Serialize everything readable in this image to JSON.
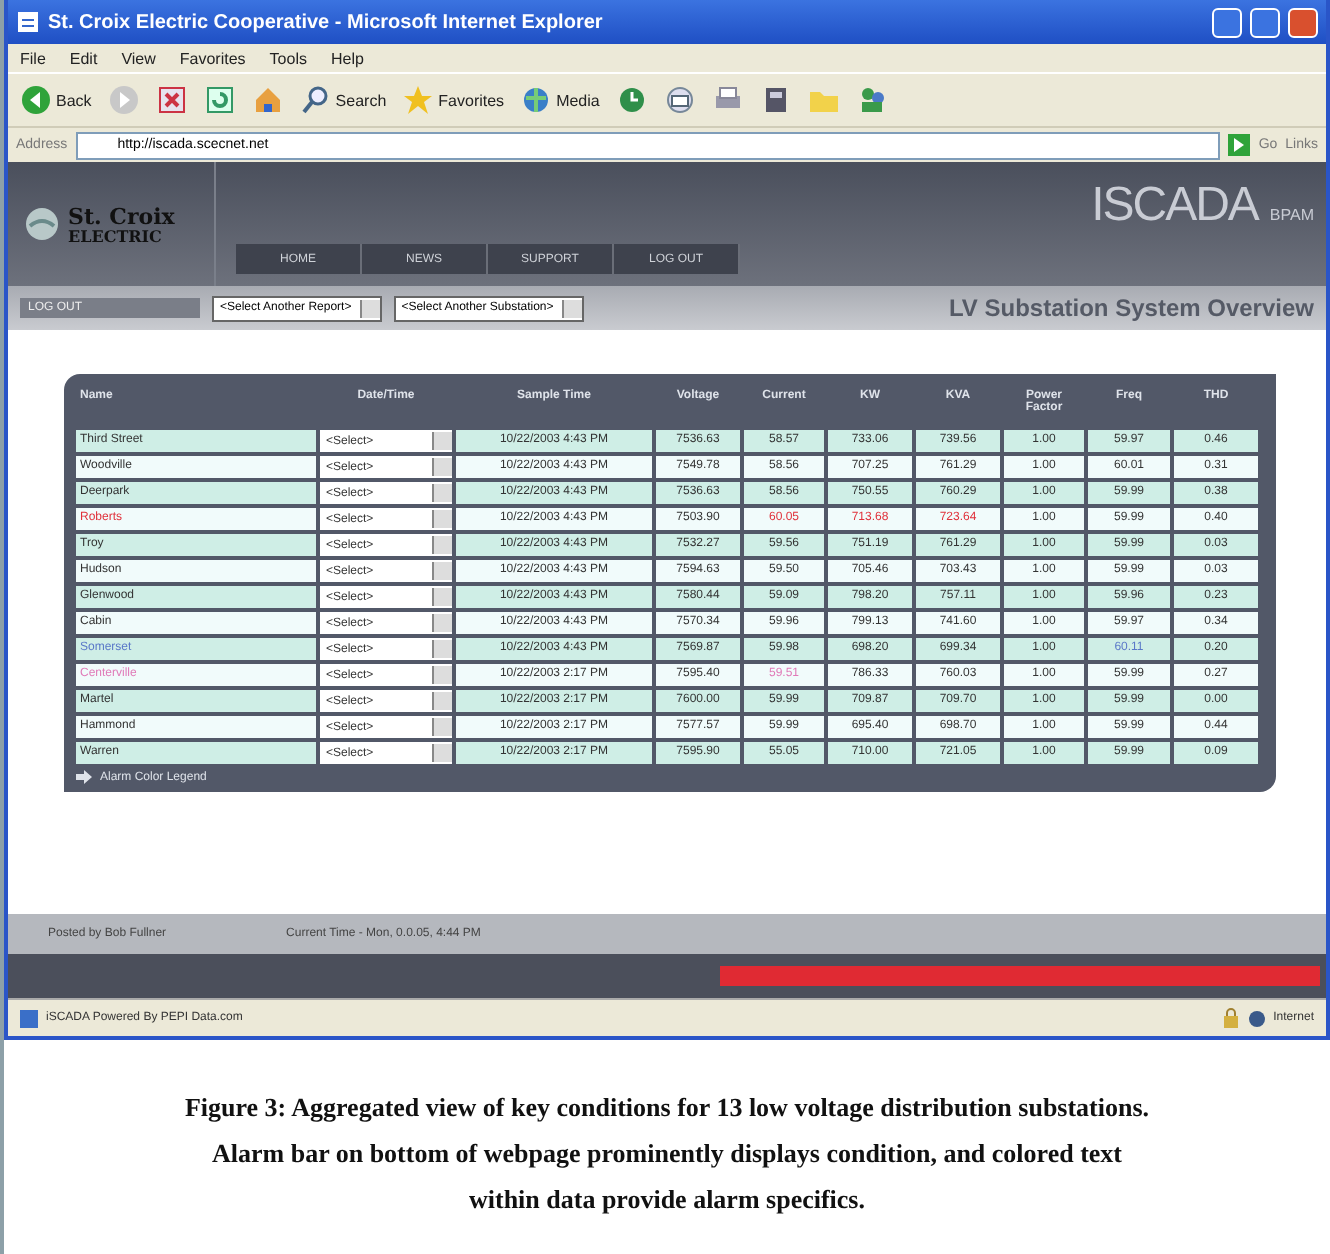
{
  "window": {
    "title": "St. Croix Electric Cooperative - Microsoft Internet Explorer"
  },
  "menu": [
    "File",
    "Edit",
    "View",
    "Favorites",
    "Tools",
    "Help"
  ],
  "toolbar": [
    {
      "kind": "back",
      "label": "Back"
    },
    {
      "kind": "forward"
    },
    {
      "kind": "stop"
    },
    {
      "kind": "refresh"
    },
    {
      "kind": "home"
    },
    {
      "kind": "search",
      "label": "Search"
    },
    {
      "kind": "favorites",
      "label": "Favorites"
    },
    {
      "kind": "media",
      "label": "Media"
    },
    {
      "kind": "history"
    },
    {
      "kind": "mail"
    },
    {
      "kind": "print"
    },
    {
      "kind": "edit"
    },
    {
      "kind": "folder"
    },
    {
      "kind": "messenger"
    }
  ],
  "address": {
    "label": "Address",
    "value": "http://iscada.scecnet.net",
    "go": "Go",
    "links": "Links"
  },
  "site": {
    "logo_line1": "St. Croix",
    "logo_line2": "ELECTRIC",
    "brand": "ISCADA",
    "brand_sub": "BPAM",
    "nav": [
      {
        "label": "HOME",
        "selected": false
      },
      {
        "label": "NEWS",
        "selected": false
      },
      {
        "label": "SUPPORT",
        "selected": false
      },
      {
        "label": "LOG OUT",
        "selected": false
      }
    ],
    "user": "LOG OUT",
    "selects": [
      "<Select Another Report>",
      "<Select Another Substation>"
    ],
    "page_title": "LV Substation System Overview"
  },
  "table": {
    "columns": [
      "Name",
      "Date/Time",
      "Sample Time",
      "Voltage",
      "Current",
      "KW",
      "KVA",
      "Power Factor",
      "Freq",
      "THD"
    ],
    "rows": [
      {
        "cells": [
          {
            "kind": "link",
            "text": "Third Street"
          },
          {
            "kind": "select",
            "text": "<Select>"
          },
          {
            "text": "10/22/2003 4:43 PM"
          },
          {
            "text": "7536.63"
          },
          {
            "text": "58.57"
          },
          {
            "text": "733.06"
          },
          {
            "text": "739.56"
          },
          {
            "text": "1.00"
          },
          {
            "text": "59.97"
          },
          {
            "text": "0.46"
          }
        ]
      },
      {
        "cells": [
          {
            "kind": "link",
            "text": "Woodville"
          },
          {
            "kind": "select",
            "text": "<Select>"
          },
          {
            "text": "10/22/2003 4:43 PM"
          },
          {
            "text": "7549.78"
          },
          {
            "text": "58.56"
          },
          {
            "text": "707.25"
          },
          {
            "text": "761.29"
          },
          {
            "text": "1.00"
          },
          {
            "text": "60.01"
          },
          {
            "text": "0.31"
          }
        ]
      },
      {
        "cells": [
          {
            "kind": "link",
            "text": "Deerpark"
          },
          {
            "kind": "select",
            "text": "<Select>"
          },
          {
            "text": "10/22/2003 4:43 PM"
          },
          {
            "text": "7536.63"
          },
          {
            "text": "58.56"
          },
          {
            "text": "750.55"
          },
          {
            "text": "760.29"
          },
          {
            "text": "1.00"
          },
          {
            "text": "59.99"
          },
          {
            "text": "0.38"
          }
        ]
      },
      {
        "cells": [
          {
            "kind": "link",
            "text": "Roberts",
            "color": "#e0303a"
          },
          {
            "kind": "select",
            "text": "<Select>"
          },
          {
            "text": "10/22/2003 4:43 PM"
          },
          {
            "text": "7503.90"
          },
          {
            "text": "60.05",
            "color": "#e0303a"
          },
          {
            "text": "713.68",
            "color": "#e0303a"
          },
          {
            "text": "723.64",
            "color": "#e0303a"
          },
          {
            "text": "1.00"
          },
          {
            "text": "59.99"
          },
          {
            "text": "0.40"
          }
        ]
      },
      {
        "cells": [
          {
            "kind": "link",
            "text": "Troy"
          },
          {
            "kind": "select",
            "text": "<Select>"
          },
          {
            "text": "10/22/2003 4:43 PM"
          },
          {
            "text": "7532.27"
          },
          {
            "text": "59.56"
          },
          {
            "text": "751.19"
          },
          {
            "text": "761.29"
          },
          {
            "text": "1.00"
          },
          {
            "text": "59.99"
          },
          {
            "text": "0.03"
          }
        ]
      },
      {
        "cells": [
          {
            "kind": "link",
            "text": "Hudson"
          },
          {
            "kind": "select",
            "text": "<Select>"
          },
          {
            "text": "10/22/2003 4:43 PM"
          },
          {
            "text": "7594.63"
          },
          {
            "text": "59.50"
          },
          {
            "text": "705.46"
          },
          {
            "text": "703.43"
          },
          {
            "text": "1.00"
          },
          {
            "text": "59.99"
          },
          {
            "text": "0.03"
          }
        ]
      },
      {
        "cells": [
          {
            "kind": "link",
            "text": "Glenwood"
          },
          {
            "kind": "select",
            "text": "<Select>"
          },
          {
            "text": "10/22/2003 4:43 PM"
          },
          {
            "text": "7580.44"
          },
          {
            "text": "59.09"
          },
          {
            "text": "798.20"
          },
          {
            "text": "757.11"
          },
          {
            "text": "1.00"
          },
          {
            "text": "59.96"
          },
          {
            "text": "0.23"
          }
        ]
      },
      {
        "cells": [
          {
            "kind": "link",
            "text": "Cabin"
          },
          {
            "kind": "select",
            "text": "<Select>"
          },
          {
            "text": "10/22/2003 4:43 PM"
          },
          {
            "text": "7570.34"
          },
          {
            "text": "59.96"
          },
          {
            "text": "799.13"
          },
          {
            "text": "741.60"
          },
          {
            "text": "1.00"
          },
          {
            "text": "59.97"
          },
          {
            "text": "0.34"
          }
        ]
      },
      {
        "cells": [
          {
            "kind": "link",
            "text": "Somerset",
            "color": "#5a78c8"
          },
          {
            "kind": "select",
            "text": "<Select>"
          },
          {
            "text": "10/22/2003 4:43 PM"
          },
          {
            "text": "7569.87"
          },
          {
            "text": "59.98"
          },
          {
            "text": "698.20"
          },
          {
            "text": "699.34"
          },
          {
            "text": "1.00"
          },
          {
            "text": "60.11",
            "color": "#5a78c8"
          },
          {
            "text": "0.20"
          }
        ]
      },
      {
        "cells": [
          {
            "kind": "link",
            "text": "Centerville",
            "color": "#e07ab8"
          },
          {
            "kind": "select",
            "text": "<Select>"
          },
          {
            "text": "10/22/2003 2:17 PM"
          },
          {
            "text": "7595.40"
          },
          {
            "text": "59.51",
            "color": "#e07ab8"
          },
          {
            "text": "786.33"
          },
          {
            "text": "760.03"
          },
          {
            "text": "1.00"
          },
          {
            "text": "59.99"
          },
          {
            "text": "0.27"
          }
        ]
      },
      {
        "cells": [
          {
            "kind": "link",
            "text": "Martel"
          },
          {
            "kind": "select",
            "text": "<Select>"
          },
          {
            "text": "10/22/2003 2:17 PM"
          },
          {
            "text": "7600.00"
          },
          {
            "text": "59.99"
          },
          {
            "text": "709.87"
          },
          {
            "text": "709.70"
          },
          {
            "text": "1.00"
          },
          {
            "text": "59.99"
          },
          {
            "text": "0.00"
          }
        ]
      },
      {
        "cells": [
          {
            "kind": "link",
            "text": "Hammond"
          },
          {
            "kind": "select",
            "text": "<Select>"
          },
          {
            "text": "10/22/2003 2:17 PM"
          },
          {
            "text": "7577.57"
          },
          {
            "text": "59.99"
          },
          {
            "text": "695.40"
          },
          {
            "text": "698.70"
          },
          {
            "text": "1.00"
          },
          {
            "text": "59.99"
          },
          {
            "text": "0.44"
          }
        ]
      },
      {
        "cells": [
          {
            "kind": "link",
            "text": "Warren"
          },
          {
            "kind": "select",
            "text": "<Select>"
          },
          {
            "text": "10/22/2003 2:17 PM"
          },
          {
            "text": "7595.90"
          },
          {
            "text": "55.05"
          },
          {
            "text": "710.00"
          },
          {
            "text": "721.05"
          },
          {
            "text": "1.00"
          },
          {
            "text": "59.99"
          },
          {
            "text": "0.09"
          }
        ]
      }
    ],
    "legend": "Alarm Color Legend"
  },
  "footer": {
    "credit": "Posted by Bob Fullner",
    "time": "Current Time - Mon, 0.0.05, 4:44 PM",
    "alarm_bar": {
      "on": true
    }
  },
  "status_bar": {
    "text": "iSCADA Powered By PEPI Data.com",
    "zone": "Internet"
  },
  "caption": [
    "Figure 3: Aggregated view of key conditions for 13 low voltage distribution substations.",
    "Alarm bar on bottom of webpage prominently displays condition, and colored text",
    "within data provide alarm specifics."
  ]
}
